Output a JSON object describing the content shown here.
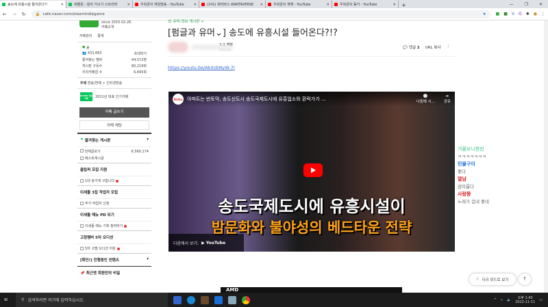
{
  "browser": {
    "tabs": [
      {
        "title": "송도에 유흥시설 들어온다?!",
        "active": true,
        "color": "#03c75a"
      },
      {
        "title": "왁물원 : 왕의 거시기 스트리머",
        "color": "#03c75a"
      },
      {
        "title": "우왁굳의 게임방송 - YouTube",
        "color": "#f00"
      },
      {
        "title": "(141) 왁타버스 WAKTAVERSE",
        "color": "#f00"
      },
      {
        "title": "우왁굳의 계책 - YouTube",
        "color": "#f00"
      },
      {
        "title": "우왁굳의 돚거 - YouTube",
        "color": "#f00"
      }
    ],
    "url": "cafe.naver.com/steamindiegame"
  },
  "sidebar": {
    "since": "since 2015.02.26.",
    "intro": "카페소개",
    "manage": "카페관리",
    "stats": "통계",
    "level": "숲",
    "members": "433,683",
    "invite": "초대하기",
    "stats_rows": [
      {
        "label": "즐겨찾는 멤버",
        "value": "44,572명"
      },
      {
        "label": "게시판 구독수",
        "value": "80,219회"
      },
      {
        "label": "우리카페앱 수",
        "value": "6,895회"
      }
    ],
    "topic_label": "주제",
    "topic": "방송/연예 > 인터넷방송",
    "badge": "NAVER 대표카페",
    "badge_text": "2021년 대표 인기카페",
    "write": "카페 글쓰기",
    "chat": "카페 채팅",
    "fav_header": "즐겨찾는 게시판",
    "all_posts": "전체글보기",
    "all_count": "6,560,174",
    "best": "베스트게시글",
    "groups": [
      {
        "head": "클립퍼 모집 지원",
        "item": "1대 왕가게 구합니다"
      },
      {
        "head": "이세돌 3집 작업자 모집",
        "item": "추가 작업자 신청"
      },
      {
        "head": "이세돌 메뉴 PD 되기",
        "item": "이세돌 메뉴 기획 참여하기"
      },
      {
        "head": "고정멤버 5차 오디션",
        "item": "5차 고멤 오디션 지원"
      }
    ],
    "progress": "[확인!] 진행중인 컨텐츠",
    "notice": "최근엔 회원만의 비밀"
  },
  "article": {
    "category": "유머,정보 게시판 >",
    "title": "[펌글과 유머⌄] 송도에 유흥시설 들어온다?!?",
    "rank": "1:1 채팅",
    "views": "조회 12",
    "comments_label": "댓글",
    "comments": "2",
    "url_copy": "URL 복사",
    "link": "https://youtu.be/AkXzbNyW-7I"
  },
  "video": {
    "channel": "Nolby",
    "title": "아파트는 반토막, 송도신도시 송도국제도시에 유흥업소와 환락가가 ...",
    "later": "나중에 시...",
    "share": "공유",
    "caption1": "송도국제도시에 유흥시설이",
    "caption2": "밤문화와 불야성의 베드타운 전략",
    "watch_on": "다음에서 보기:",
    "youtube": "YouTube"
  },
  "ad": {
    "brand": "AMD"
  },
  "chat": [
    {
      "name": "거울보니원빈",
      "msg": "ㅋㅋㅋㅋㅋㅋㅋ",
      "color": "#7fd6b0"
    },
    {
      "name": "민물구이",
      "msg": "좋다",
      "color": "#1a6fd6"
    },
    {
      "name": "열남",
      "msg": "감미롭다",
      "color": "#d61a1a"
    },
    {
      "name": "사랑짱",
      "msg": "노래가 겁내 좋네",
      "color": "#d61a1a"
    }
  ],
  "floating": {
    "dark_mode": "다크 모드로 보기",
    "top": "↑"
  },
  "taskbar": {
    "search": "검색하려면 여기에 입력하십시오.",
    "time": "오후 1:43",
    "date": "2022-11-11"
  }
}
